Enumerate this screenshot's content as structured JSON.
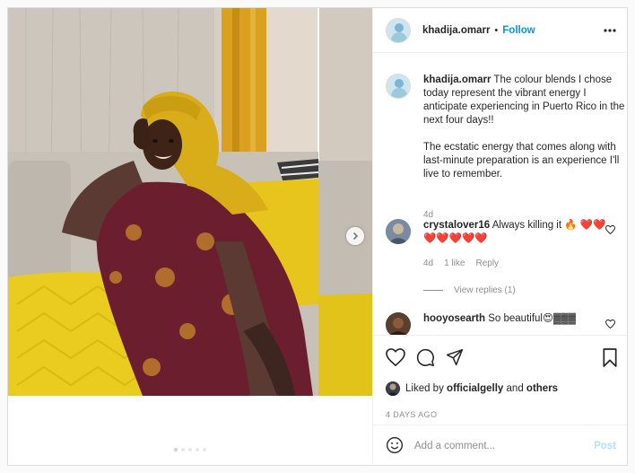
{
  "post": {
    "username": "khadija.omarr",
    "follow_label": "Follow",
    "separator": "•",
    "caption_p1": "The colour blends I chose today represent the vibrant energy I anticipate experiencing in Puerto Rico in the next four days!!",
    "caption_p2": "The ecstatic energy that comes along with last-minute preparation is an experience I'll live to remember.",
    "caption_time": "4d",
    "image_carousel": {
      "slide_count": 5,
      "active_slide": 1
    }
  },
  "comments": [
    {
      "username": "crystalover16",
      "text": "Always killing it 🔥 ❤️❤️❤️❤️❤️❤️❤️",
      "time": "4d",
      "likes": "1 like",
      "reply_label": "Reply",
      "view_replies": "View replies (1)"
    },
    {
      "username": "hooyosearth",
      "text": "So beautiful😍▓▓▓"
    }
  ],
  "likes": {
    "prefix": "Liked by",
    "user": "officialgelly",
    "and": "and",
    "others": "others"
  },
  "timestamp": "4 DAYS AGO",
  "comment_box": {
    "placeholder": "Add a comment...",
    "post_label": "Post"
  },
  "icons": {
    "more": "more-options-icon",
    "heart": "heart-icon",
    "comment": "comment-icon",
    "share": "share-icon",
    "save": "bookmark-icon",
    "emoji": "emoji-icon",
    "next": "chevron-right-icon"
  },
  "colors": {
    "accent": "#0095f6",
    "post_disabled": "#b2dffc",
    "muted": "#8e8e8e",
    "border": "#dbdbdb"
  }
}
